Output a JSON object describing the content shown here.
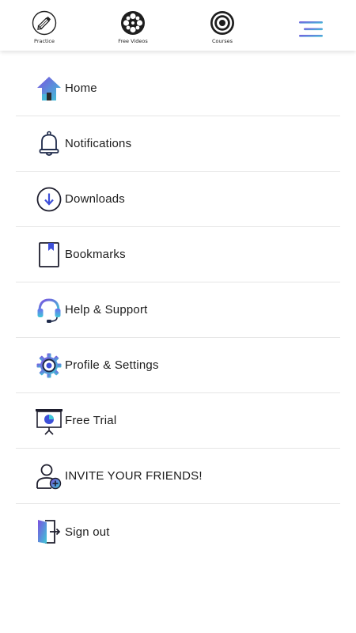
{
  "tabs": [
    {
      "label": "Practice",
      "icon": "pencil-icon"
    },
    {
      "label": "Free Videos",
      "icon": "film-reel-icon"
    },
    {
      "label": "Courses",
      "icon": "target-icon"
    }
  ],
  "menu_icon": "hamburger-menu-icon",
  "menu": [
    {
      "label": "Home",
      "icon": "home-icon"
    },
    {
      "label": "Notifications",
      "icon": "bell-icon"
    },
    {
      "label": "Downloads",
      "icon": "download-icon"
    },
    {
      "label": "Bookmarks",
      "icon": "bookmark-icon"
    },
    {
      "label": "Help & Support",
      "icon": "headset-icon"
    },
    {
      "label": "Profile & Settings",
      "icon": "gear-icon"
    },
    {
      "label": "Free Trial",
      "icon": "presentation-icon"
    },
    {
      "label": "INVITE YOUR FRIENDS!",
      "icon": "add-user-icon"
    },
    {
      "label": "Sign out",
      "icon": "sign-out-icon"
    }
  ],
  "colors": {
    "gradient_start": "#7b4fe0",
    "gradient_end": "#3ec9d6",
    "divider": "#e6e6e6",
    "text": "#1c1c1c"
  }
}
